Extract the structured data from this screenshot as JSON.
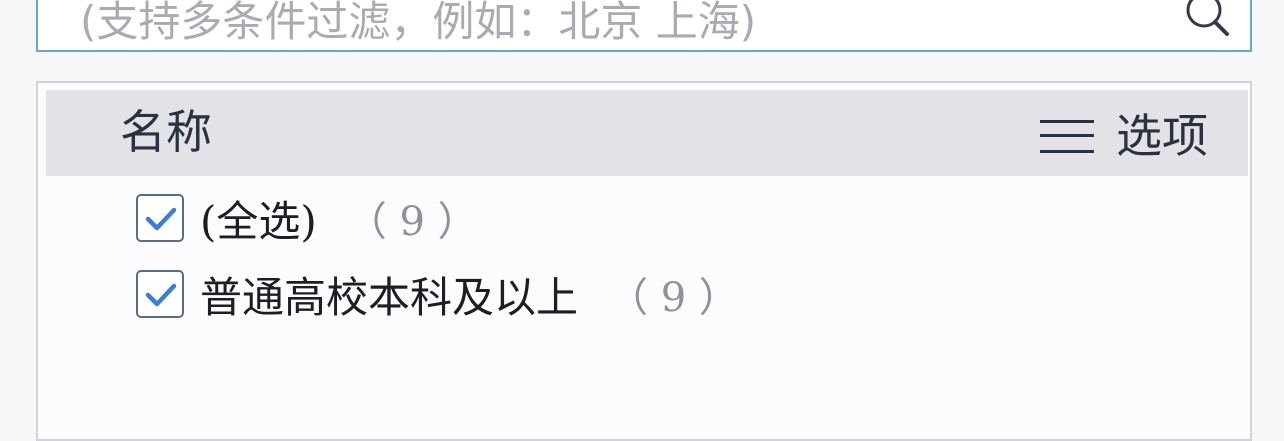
{
  "search": {
    "placeholder": "(支持多条件过滤，例如：北京 上海)",
    "icon": "search-icon"
  },
  "panel": {
    "header_title": "名称",
    "options_label": "选项",
    "options_icon": "menu-icon",
    "items": [
      {
        "label": "(全选)",
        "count": "（ 9 ）",
        "checked": true
      },
      {
        "label": "普通高校本科及以上",
        "count": "（ 9 ）",
        "checked": true
      }
    ]
  },
  "colors": {
    "border_accent": "#6aa6c8",
    "check_color": "#3d7bd6",
    "header_bg": "#e3e3e7"
  }
}
